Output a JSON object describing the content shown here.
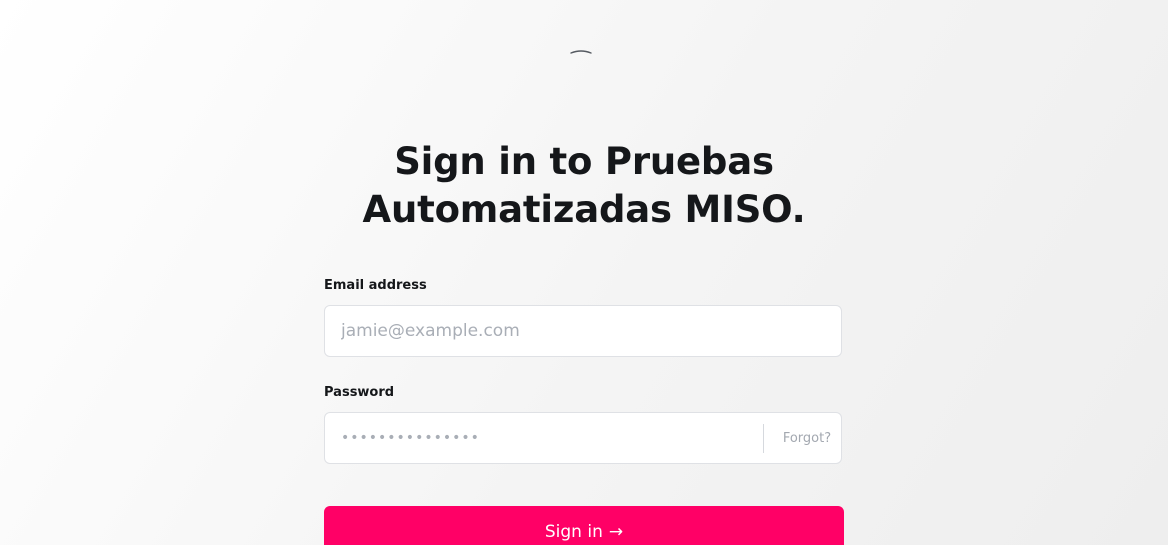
{
  "logo": {
    "icon": "spinner-arc-icon"
  },
  "title": "Sign in to Pruebas Automatizadas MISO.",
  "email": {
    "label": "Email address",
    "placeholder": "jamie@example.com",
    "value": ""
  },
  "password": {
    "label": "Password",
    "placeholder": "•••••••••••••••",
    "value": "",
    "forgot_label": "Forgot?"
  },
  "submit": {
    "label": "Sign in",
    "arrow": "→"
  },
  "colors": {
    "accent": "#ff0066",
    "title": "#15171a",
    "placeholder": "#a9aeb6",
    "border": "#dfe1e5"
  }
}
